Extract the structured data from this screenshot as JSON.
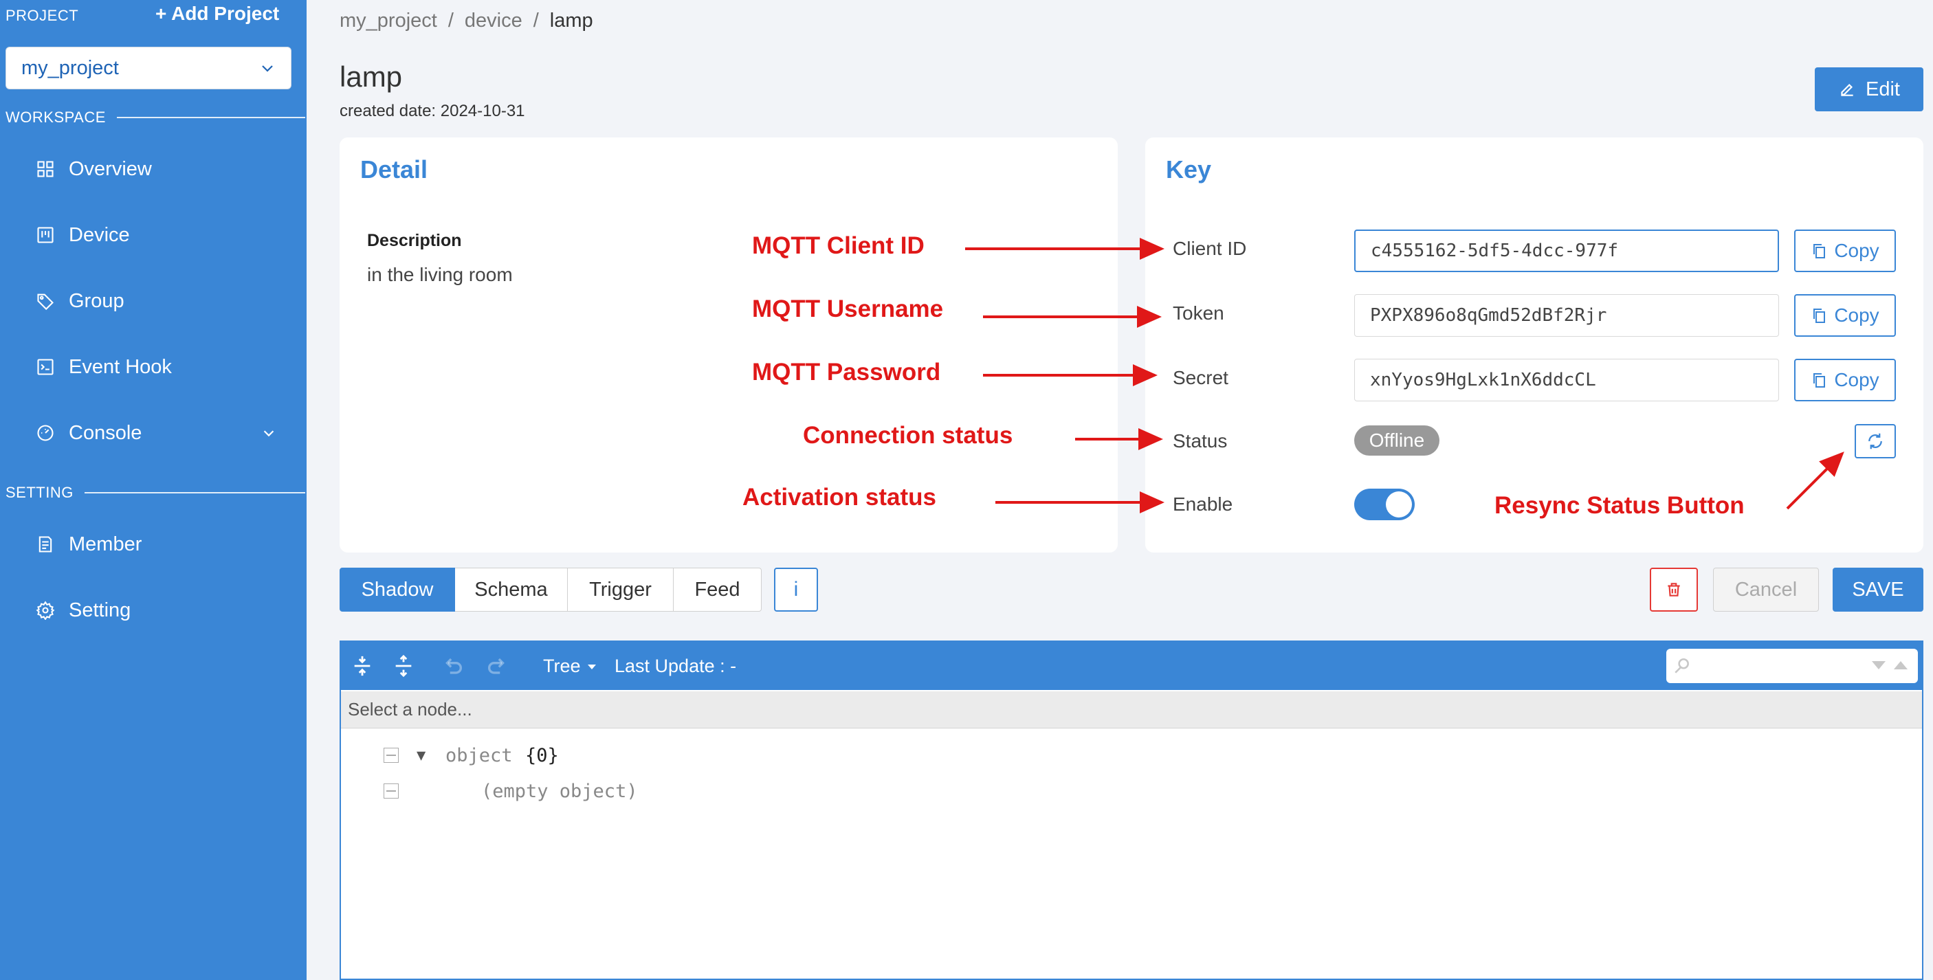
{
  "sidebar": {
    "project_label": "PROJECT",
    "add_project": "+ Add Project",
    "selected_project": "my_project",
    "workspace_label": "WORKSPACE",
    "setting_label": "SETTING",
    "items": [
      {
        "label": "Overview",
        "icon": "grid-icon"
      },
      {
        "label": "Device",
        "icon": "device-icon"
      },
      {
        "label": "Group",
        "icon": "tag-icon"
      },
      {
        "label": "Event Hook",
        "icon": "terminal-icon"
      },
      {
        "label": "Console",
        "icon": "dashboard-icon"
      },
      {
        "label": "Member",
        "icon": "document-icon"
      },
      {
        "label": "Setting",
        "icon": "gear-icon"
      }
    ],
    "accent_color": "#3a86d6"
  },
  "breadcrumb": [
    "my_project",
    "/",
    "device",
    "/",
    "lamp"
  ],
  "page": {
    "title": "lamp",
    "created": "created date: 2024-10-31",
    "edit_label": "Edit"
  },
  "detail": {
    "title": "Detail",
    "description_label": "Description",
    "description_value": "in the living room"
  },
  "key": {
    "title": "Key",
    "client_id_label": "Client ID",
    "client_id_value": "c4555162-5df5-4dcc-977f",
    "token_label": "Token",
    "token_value": "PXPX896o8qGmd52dBf2Rjr",
    "secret_label": "Secret",
    "secret_value": "xnYyos9HgLxk1nX6ddcCL",
    "copy_label": "Copy",
    "status_label": "Status",
    "status_value": "Offline",
    "enable_label": "Enable",
    "enabled": true
  },
  "annotations": {
    "client_id": "MQTT Client ID",
    "username": "MQTT Username",
    "password": "MQTT Password",
    "connection": "Connection status",
    "activation": "Activation status",
    "resync": "Resync Status Button",
    "color": "#e01818"
  },
  "tabs": {
    "items": [
      "Shadow",
      "Schema",
      "Trigger",
      "Feed"
    ],
    "active": "Shadow",
    "info_label": "i",
    "cancel_label": "Cancel",
    "save_label": "SAVE"
  },
  "editor": {
    "mode": "Tree",
    "last_update": "Last Update : -",
    "nav_placeholder": "Select a node...",
    "root_key": "object",
    "root_count": "{0}",
    "empty_label": "(empty object)"
  }
}
